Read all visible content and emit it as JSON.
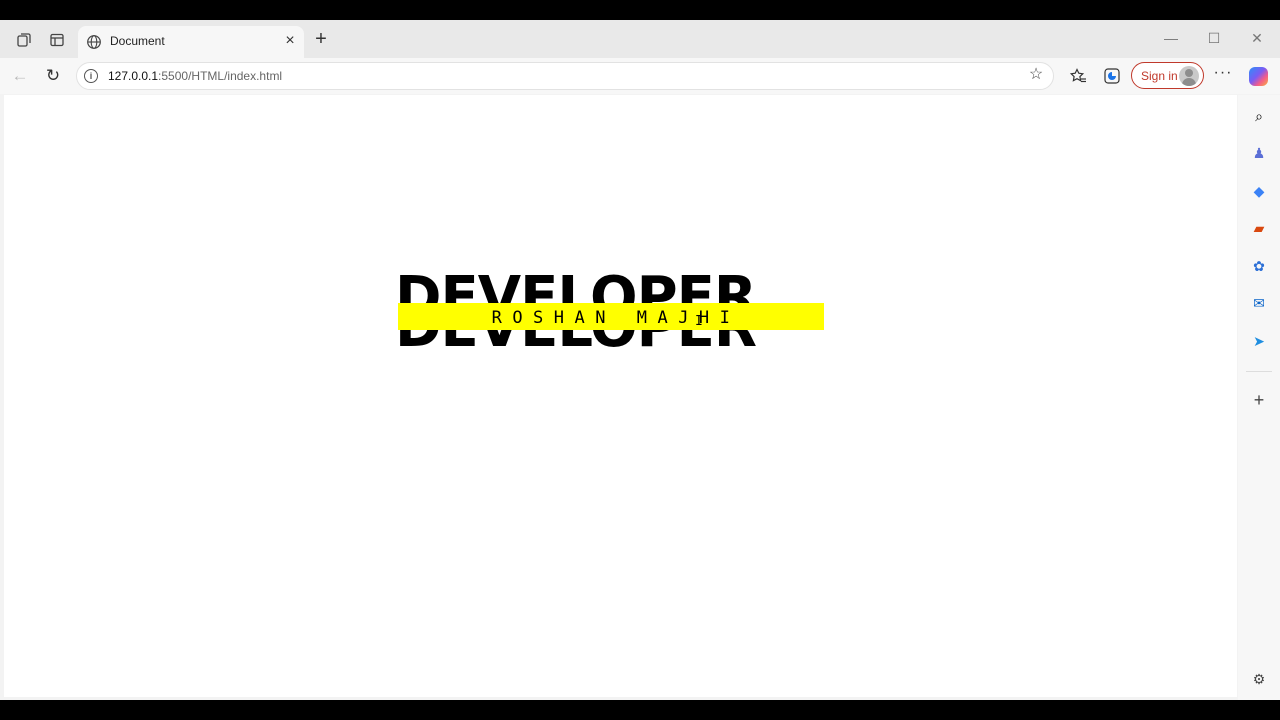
{
  "browser": {
    "tab": {
      "title": "Document",
      "close_glyph": "×"
    },
    "new_tab_glyph": "+",
    "window_controls": {
      "minimize": "—",
      "maximize": "☐",
      "close": "✕"
    },
    "toolbar": {
      "back_glyph": "←",
      "reload_glyph": "↻",
      "url_host": "127.0.0.1",
      "url_path": ":5500/HTML/index.html",
      "favorite_glyph": "☆",
      "signin_label": "Sign in",
      "more_glyph": "···"
    },
    "icons": [
      "collections-icon",
      "tab-actions-icon",
      "favorites-icon",
      "browser-essentials-icon",
      "profile-avatar-icon",
      "copilot-icon"
    ],
    "sidebar": {
      "items": [
        {
          "name": "search-icon",
          "glyph": "⌕",
          "color": "#444444"
        },
        {
          "name": "people-icon",
          "glyph": "♟",
          "color": "#5b6fd6"
        },
        {
          "name": "shopping-tag-icon",
          "glyph": "◆",
          "color": "#3b82f6"
        },
        {
          "name": "tools-briefcase-icon",
          "glyph": "▰",
          "color": "#d9480f"
        },
        {
          "name": "microsoft365-icon",
          "glyph": "✿",
          "color": "#2b6fd6"
        },
        {
          "name": "outlook-icon",
          "glyph": "✉",
          "color": "#0a64c9"
        },
        {
          "name": "drop-send-icon",
          "glyph": "➤",
          "color": "#1f8ee0"
        }
      ],
      "add_glyph": "+",
      "settings_glyph": "⚙"
    }
  },
  "page": {
    "headline": "DEVELOPER",
    "name_banner": "ROSHAN MAJHI",
    "banner_color": "#ffff00",
    "cursor_glyph": "I"
  }
}
